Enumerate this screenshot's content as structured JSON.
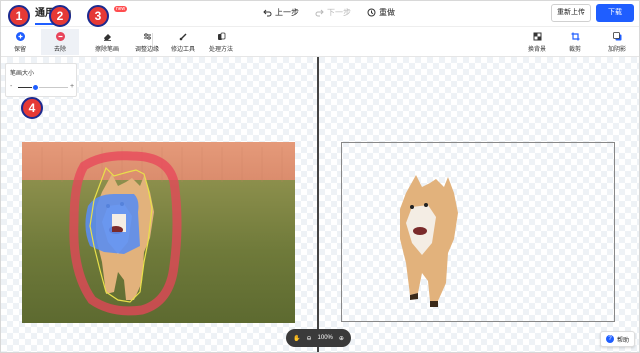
{
  "header": {
    "tab_active": "通用",
    "tab_second": "",
    "badge": "new",
    "undo": "上一步",
    "redo": "下一步",
    "reset": "重做",
    "reupload": "重新上传",
    "download": "下载"
  },
  "toolbar": {
    "keep": "保留",
    "remove": "去除",
    "erase_brush": "擦除笔画",
    "adjust_edge": "调整边缘",
    "edge_tool": "修边工具",
    "process_method": "处理方法",
    "change_bg": "换背景",
    "crop": "裁剪",
    "shadow": "加阴影"
  },
  "brush": {
    "label": "笔画大小",
    "value_fraction": 0.35
  },
  "zoom": {
    "level": "100%"
  },
  "help": {
    "label": "帮助"
  },
  "markers": [
    "1",
    "2",
    "3",
    "4"
  ],
  "colors": {
    "accent": "#1f5eff",
    "marker_fill": "#e53935",
    "marker_border": "#1c2a8f",
    "remove_stroke": "#e8445a",
    "keep_fill": "#5b8def"
  }
}
